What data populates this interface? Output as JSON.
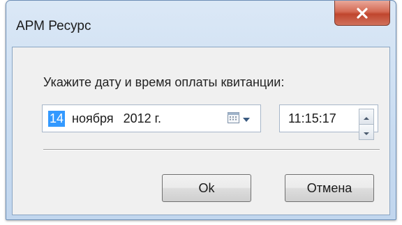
{
  "window": {
    "title": "АРМ Ресурс"
  },
  "dialog": {
    "prompt": "Укажите дату и время оплаты квитанции:",
    "date": {
      "day": "14",
      "month": "ноября",
      "year": "2012 г."
    },
    "time": {
      "value": "11:15:17"
    },
    "buttons": {
      "ok": "Ok",
      "cancel": "Отмена"
    }
  },
  "icons": {
    "close": "close-icon",
    "calendar": "calendar-icon",
    "dropdown": "chevron-down-icon",
    "spin_up": "spin-up-icon",
    "spin_down": "spin-down-icon"
  },
  "colors": {
    "close_button": "#c9553d",
    "selection": "#3399ff",
    "frame": "#c9dcf1"
  }
}
